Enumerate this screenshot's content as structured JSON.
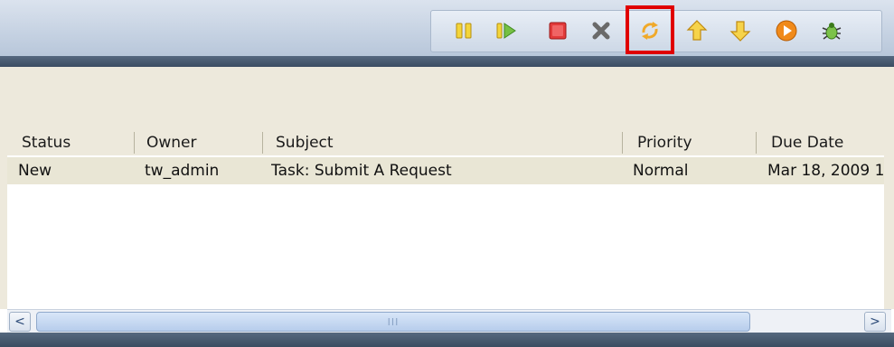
{
  "toolbar": {
    "buttons": [
      {
        "name": "pause",
        "icon": "pause-icon"
      },
      {
        "name": "resume",
        "icon": "resume-icon"
      },
      {
        "name": "stop",
        "icon": "stop-icon"
      },
      {
        "name": "delete",
        "icon": "close-x-icon"
      },
      {
        "name": "refresh",
        "icon": "refresh-arrows-icon"
      },
      {
        "name": "move-up",
        "icon": "arrow-up-icon"
      },
      {
        "name": "move-down",
        "icon": "arrow-down-icon"
      },
      {
        "name": "run",
        "icon": "play-circle-icon"
      },
      {
        "name": "debug",
        "icon": "bug-icon"
      }
    ],
    "highlighted": "refresh"
  },
  "table": {
    "columns": [
      "Status",
      "Owner",
      "Subject",
      "Priority",
      "Due Date"
    ],
    "rows": [
      [
        "New",
        "tw_admin",
        "Task: Submit A Request",
        "Normal",
        "Mar 18, 2009 1"
      ]
    ]
  },
  "scrollbar": {
    "left_label": "<",
    "right_label": ">",
    "grip": "III"
  },
  "colors": {
    "highlight": "#e00000",
    "row_bg": "#e9e6d5",
    "panel_bg": "#ede9dc"
  }
}
